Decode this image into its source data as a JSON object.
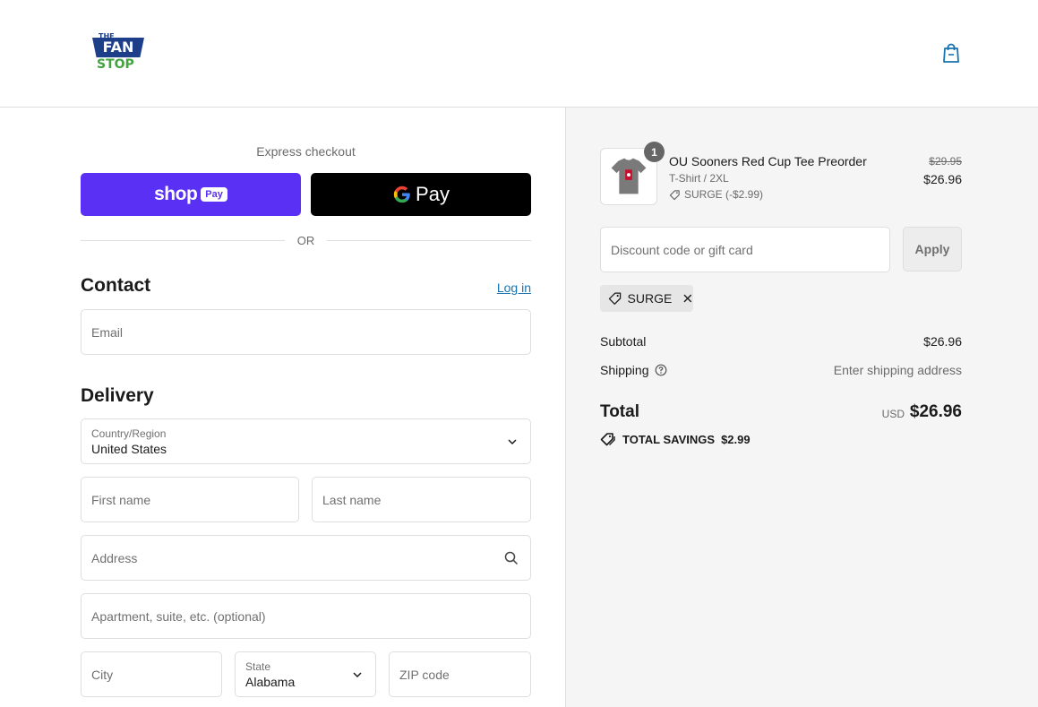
{
  "brand": {
    "logo_top": "THE",
    "logo_main": "FAN",
    "logo_bottom": "STOP"
  },
  "express": {
    "title": "Express checkout",
    "shop_pay": {
      "word": "shop",
      "pill": "Pay"
    },
    "google_pay": {
      "text": "Pay"
    },
    "or": "OR"
  },
  "contact": {
    "title": "Contact",
    "login": "Log in",
    "email_placeholder": "Email"
  },
  "delivery": {
    "title": "Delivery",
    "country_label": "Country/Region",
    "country_value": "United States",
    "first_name": "First name",
    "last_name": "Last name",
    "address": "Address",
    "apartment": "Apartment, suite, etc. (optional)",
    "city": "City",
    "state_label": "State",
    "state_value": "Alabama",
    "zip": "ZIP code"
  },
  "order": {
    "item": {
      "qty": "1",
      "name": "OU Sooners Red Cup Tee Preorder",
      "variant": "T-Shirt / 2XL",
      "discount": "SURGE (-$2.99)",
      "old_price": "$29.95",
      "price": "$26.96"
    },
    "discount_placeholder": "Discount code or gift card",
    "apply": "Apply",
    "chip": "SURGE",
    "subtotal_label": "Subtotal",
    "subtotal_value": "$26.96",
    "shipping_label": "Shipping",
    "shipping_value": "Enter shipping address",
    "total_label": "Total",
    "currency": "USD",
    "total_value": "$26.96",
    "savings_label": "TOTAL SAVINGS",
    "savings_value": "$2.99"
  },
  "colors": {
    "shop_pay": "#5a31f4",
    "link": "#1773b0",
    "summary_bg": "#f5f5f5"
  }
}
